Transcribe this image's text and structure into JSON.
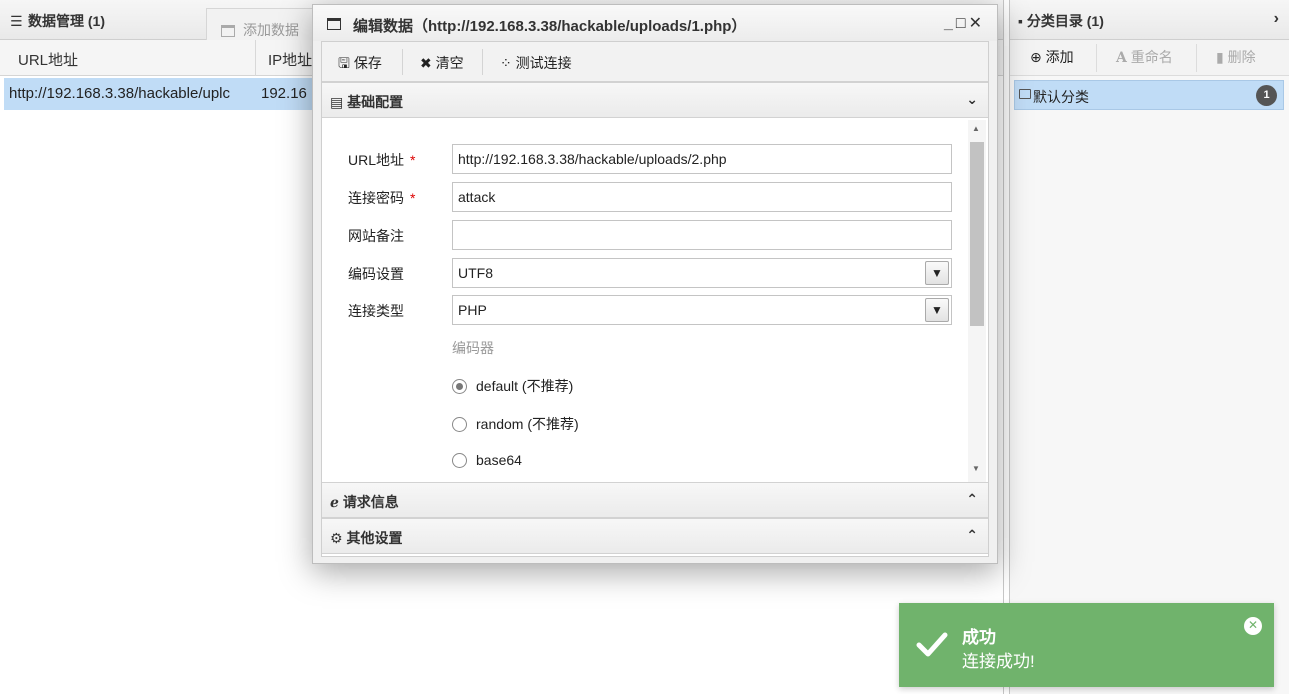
{
  "data_panel": {
    "title": "数据管理 (1)",
    "add_tab_label": "添加数据",
    "columns": [
      "URL地址",
      "IP地址"
    ],
    "rows": [
      {
        "url": "http://192.168.3.38/hackable/uplc",
        "ip": "192.16"
      }
    ]
  },
  "category_panel": {
    "title": "分类目录 (1)",
    "toolbar": {
      "add": "添加",
      "rename": "重命名",
      "delete": "删除"
    },
    "items": [
      {
        "label": "默认分类",
        "count": "1"
      }
    ]
  },
  "dialog": {
    "title": "编辑数据（http://192.168.3.38/hackable/uploads/1.php）",
    "toolbar": {
      "save": "保存",
      "clear": "清空",
      "test": "测试连接"
    },
    "sections": {
      "basic": "基础配置",
      "request": "请求信息",
      "other": "其他设置"
    },
    "form": {
      "url_label": "URL地址",
      "url_value": "http://192.168.3.38/hackable/uploads/2.php",
      "password_label": "连接密码",
      "password_value": "attack",
      "note_label": "网站备注",
      "note_value": "",
      "encoding_label": "编码设置",
      "encoding_value": "UTF8",
      "type_label": "连接类型",
      "type_value": "PHP",
      "encoder_label": "编码器",
      "encoders": [
        "default (不推荐)",
        "random (不推荐)",
        "base64"
      ],
      "required_mark": "*"
    }
  },
  "toast": {
    "title": "成功",
    "message": "连接成功!",
    "color": "#70b36c"
  }
}
